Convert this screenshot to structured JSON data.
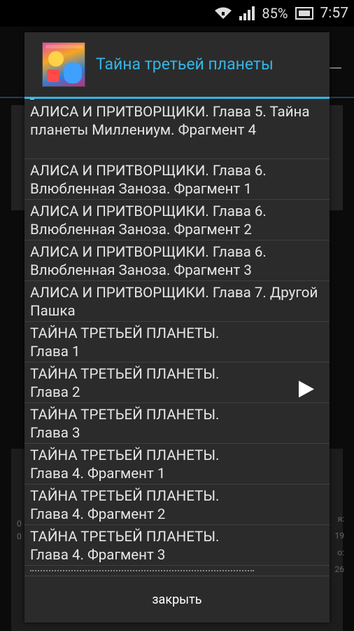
{
  "status_bar": {
    "battery_percent": "85%",
    "time": "7:57"
  },
  "background": {
    "left_text": [
      "0",
      "0"
    ],
    "right_text": [
      "я:",
      "19",
      "о:",
      "26"
    ]
  },
  "dialog": {
    "title": "Тайна третьей планеты",
    "items": [
      {
        "text": "АЛИСА И ПРИТВОРЩИКИ. Глава 5. Тайна планеты Миллениум. Фрагмент 4"
      },
      {
        "text": "АЛИСА И ПРИТВОРЩИКИ. Глава 6. Влюбленная Заноза. Фрагмент 1"
      },
      {
        "text": "АЛИСА И ПРИТВОРЩИКИ. Глава 6. Влюбленная Заноза. Фрагмент 2"
      },
      {
        "text": "АЛИСА И ПРИТВОРЩИКИ. Глава 6. Влюбленная Заноза. Фрагмент 3"
      },
      {
        "text": "АЛИСА И ПРИТВОРЩИКИ. Глава 7. Другой Пашка"
      },
      {
        "text": "ТАЙНА ТРЕТЬЕЙ ПЛАНЕТЫ. Глава 1"
      },
      {
        "text": "ТАЙНА ТРЕТЬЕЙ ПЛАНЕТЫ. Глава 2"
      },
      {
        "text": "ТАЙНА ТРЕТЬЕЙ ПЛАНЕТЫ. Глава 3"
      },
      {
        "text": "ТАЙНА ТРЕТЬЕЙ ПЛАНЕТЫ. Глава 4. Фрагмент 1"
      },
      {
        "text": "ТАЙНА ТРЕТЬЕЙ ПЛАНЕТЫ. Глава 4. Фрагмент 2"
      },
      {
        "text": "ТАЙНА ТРЕТЬЕЙ ПЛАНЕТЫ. Глава 4. Фрагмент 3"
      }
    ],
    "close_label": "закрыть",
    "playing_icon": "play-icon"
  },
  "colors": {
    "accent": "#33b5e5",
    "dialog_bg": "#2b2b2b"
  }
}
